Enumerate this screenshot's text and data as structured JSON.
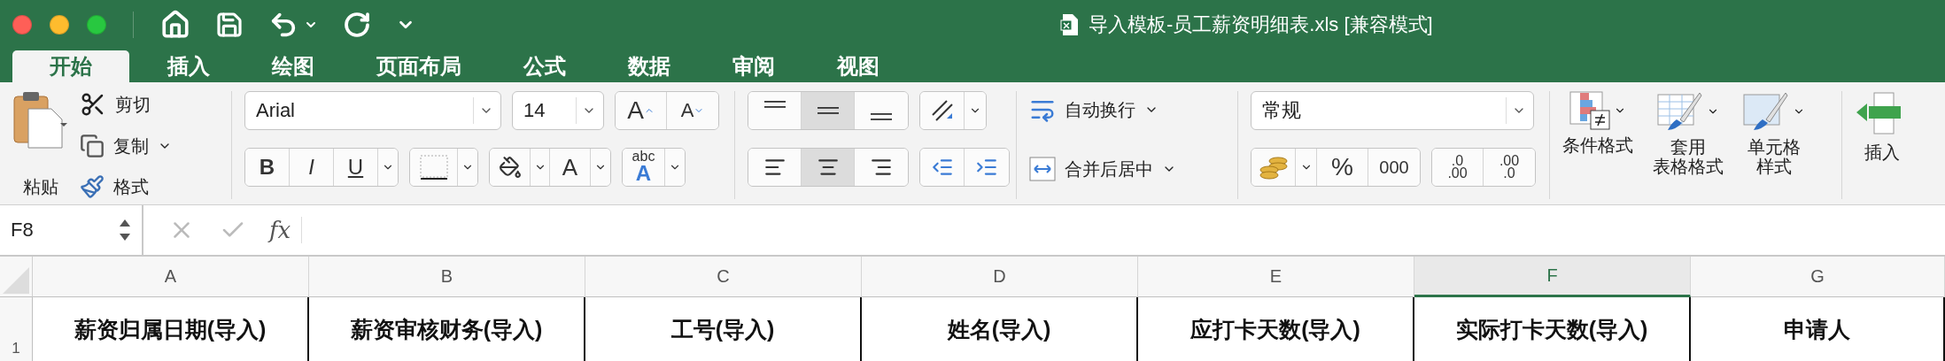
{
  "window": {
    "title": "导入模板-员工薪资明细表.xls [兼容模式]"
  },
  "tabs": [
    {
      "label": "开始",
      "selected": true
    },
    {
      "label": "插入",
      "selected": false
    },
    {
      "label": "绘图",
      "selected": false
    },
    {
      "label": "页面布局",
      "selected": false
    },
    {
      "label": "公式",
      "selected": false
    },
    {
      "label": "数据",
      "selected": false
    },
    {
      "label": "审阅",
      "selected": false
    },
    {
      "label": "视图",
      "selected": false
    }
  ],
  "ribbon": {
    "clipboard": {
      "paste": "粘贴",
      "cut": "剪切",
      "copy": "复制",
      "format_painter": "格式"
    },
    "font": {
      "name": "Arial",
      "size": "14",
      "grow": "A",
      "shrink": "A",
      "bold": "B",
      "italic": "I",
      "underline": "U",
      "font_color": "A",
      "phonetic_top": "abc",
      "phonetic_bottom": "A"
    },
    "alignment": {
      "vertical": [
        {
          "selected": false
        },
        {
          "selected": true
        },
        {
          "selected": false
        }
      ],
      "horizontal": [
        {
          "selected": false
        },
        {
          "selected": true
        },
        {
          "selected": false
        }
      ]
    },
    "wrap_text": "自动换行",
    "merge_center": "合并后居中",
    "number": {
      "format": "常规",
      "percent": "%",
      "comma": "000",
      "increase_decimal": [
        ".0",
        ".00"
      ],
      "decrease_decimal": [
        ".00",
        ".0"
      ]
    },
    "styles": [
      {
        "label_lines": [
          "条件格式"
        ],
        "kind": "conditional"
      },
      {
        "label_lines": [
          "套用",
          "表格格式"
        ],
        "kind": "table"
      },
      {
        "label_lines": [
          "单元格",
          "样式"
        ],
        "kind": "cell"
      }
    ],
    "insert": "插入"
  },
  "formula_bar": {
    "name_box": "F8",
    "function_label": "fx"
  },
  "sheet": {
    "columns": [
      {
        "label": "A",
        "selected": false
      },
      {
        "label": "B",
        "selected": false
      },
      {
        "label": "C",
        "selected": false
      },
      {
        "label": "D",
        "selected": false
      },
      {
        "label": "E",
        "selected": false
      },
      {
        "label": "F",
        "selected": true
      },
      {
        "label": "G",
        "selected": false
      }
    ],
    "rows": [
      {
        "number": "1",
        "cells": [
          "薪资归属日期(导入)",
          "薪资审核财务(导入)",
          "工号(导入)",
          "姓名(导入)",
          "应打卡天数(导入)",
          "实际打卡天数(导入)",
          "申请人"
        ]
      }
    ]
  }
}
